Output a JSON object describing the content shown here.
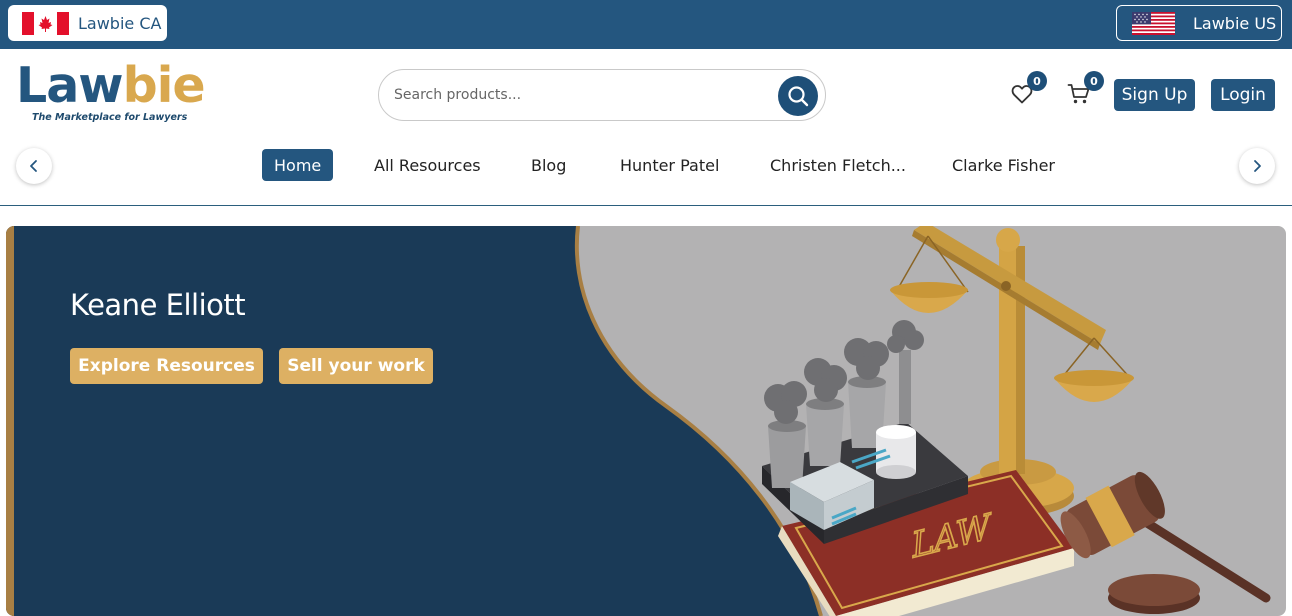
{
  "topbar": {
    "region_ca_label": "Lawbie CA",
    "region_us_label": "Lawbie US"
  },
  "header": {
    "logo_part1": "Law",
    "logo_part2": "bie",
    "logo_tagline": "The Marketplace for Lawyers",
    "search_placeholder": "Search products...",
    "wishlist_count": "0",
    "cart_count": "0",
    "signup_label": "Sign Up",
    "login_label": "Login"
  },
  "nav": {
    "items": [
      {
        "label": "Home",
        "active": true
      },
      {
        "label": "All Resources"
      },
      {
        "label": "Blog"
      },
      {
        "label": "Hunter Patel"
      },
      {
        "label": "Christen Fletch..."
      },
      {
        "label": "Clarke Fisher"
      }
    ]
  },
  "hero": {
    "title": "Keane Elliott",
    "explore_label": "Explore Resources",
    "sell_label": "Sell your work",
    "book_text": "LAW"
  },
  "colors": {
    "primary": "#24567f",
    "hero_navy": "#1a3a57",
    "gold": "#ddb063",
    "hero_gray": "#b3b2b3"
  }
}
